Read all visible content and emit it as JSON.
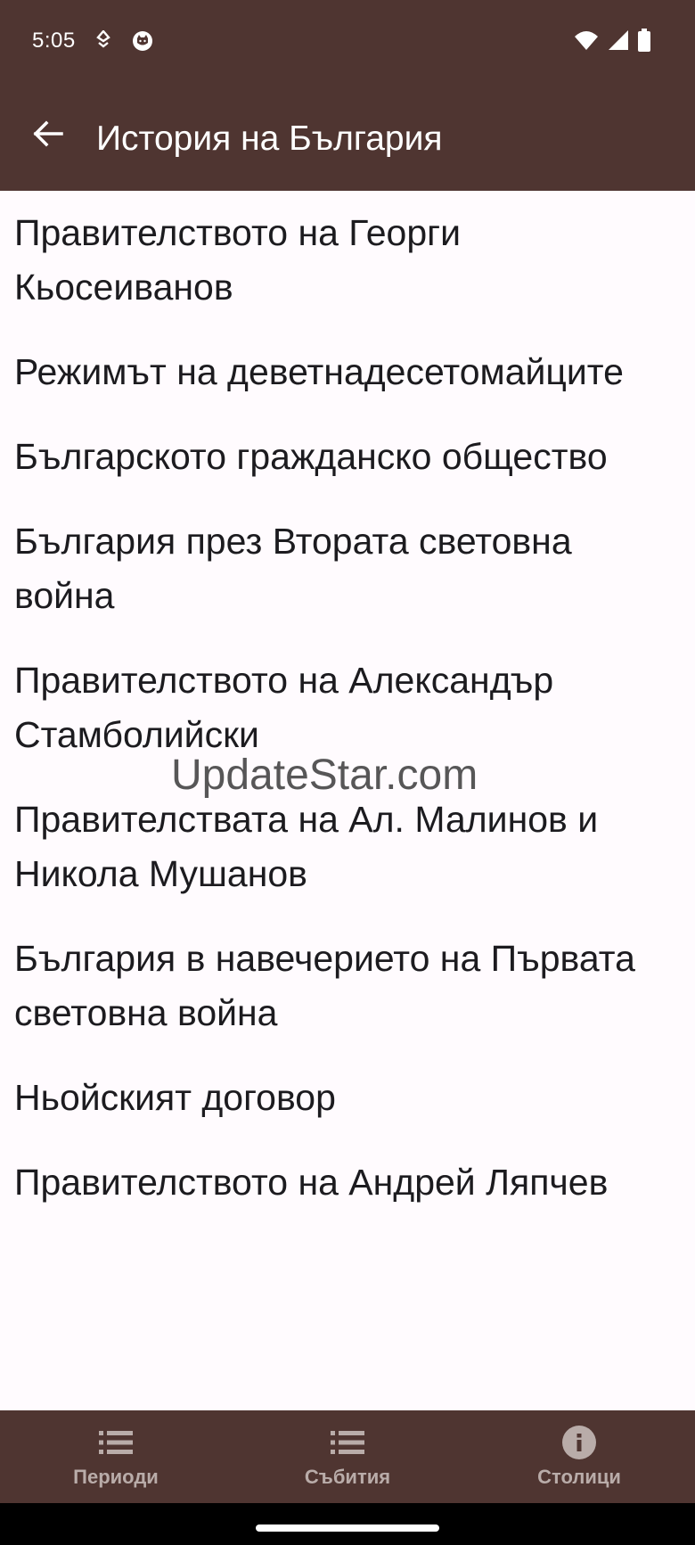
{
  "status_bar": {
    "time": "5:05",
    "icons_left": [
      "location-pin-icon",
      "cat-notification-icon"
    ],
    "icons_right": [
      "wifi-icon",
      "signal-icon",
      "battery-icon"
    ]
  },
  "app_bar": {
    "title": "История на България",
    "back_icon": "arrow-back-icon"
  },
  "list": {
    "items": [
      "Правителството на Георги Кьосеиванов",
      "Режимът на деветнадесетомайците",
      "Българското гражданско общество",
      "България през Втората световна война",
      "Правителството на Александър Стамболийски",
      "Правителствата на Ал. Малинов и Никола Мушанов",
      "България в навечерието на Първата световна война",
      "Ньойският договор",
      "Правителството на Андрей Ляпчев"
    ]
  },
  "watermark": "UpdateStar.com",
  "bottom_nav": {
    "items": [
      {
        "label": "Периоди",
        "icon": "list-icon"
      },
      {
        "label": "Събития",
        "icon": "list-icon"
      },
      {
        "label": "Столици",
        "icon": "info-icon"
      }
    ]
  },
  "colors": {
    "bar_background": "#4f3531",
    "page_background": "#fffbfe",
    "text": "#1c1b1f",
    "nav_inactive": "#b9aca9"
  }
}
